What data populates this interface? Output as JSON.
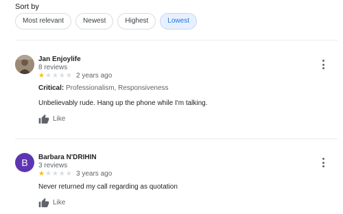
{
  "sort": {
    "label": "Sort by",
    "options": [
      "Most relevant",
      "Newest",
      "Highest",
      "Lowest"
    ],
    "selected": "Lowest"
  },
  "reviews": [
    {
      "name": "Jan Enjoylife",
      "review_count": "8 reviews",
      "rating": 1,
      "max_rating": 5,
      "time": "2 years ago",
      "critical_label": "Critical:",
      "critical_value": "Professionalism, Responsiveness",
      "text": "Unbelievably rude. Hang up the phone while I'm talking.",
      "like_label": "Like",
      "avatar_icon": "profile-photo"
    },
    {
      "name": "Barbara N'DRIHIN",
      "review_count": "3 reviews",
      "rating": 1,
      "max_rating": 5,
      "time": "3 years ago",
      "text": "Never returned my call regarding as quotation",
      "like_label": "Like",
      "avatar_letter": "B",
      "avatar_color": "#5e35b1"
    }
  ],
  "colors": {
    "star_filled": "#fbbc04",
    "star_empty": "#dadce0",
    "chip_active_bg": "#e8f0fe",
    "chip_active_text": "#1a73e8"
  }
}
